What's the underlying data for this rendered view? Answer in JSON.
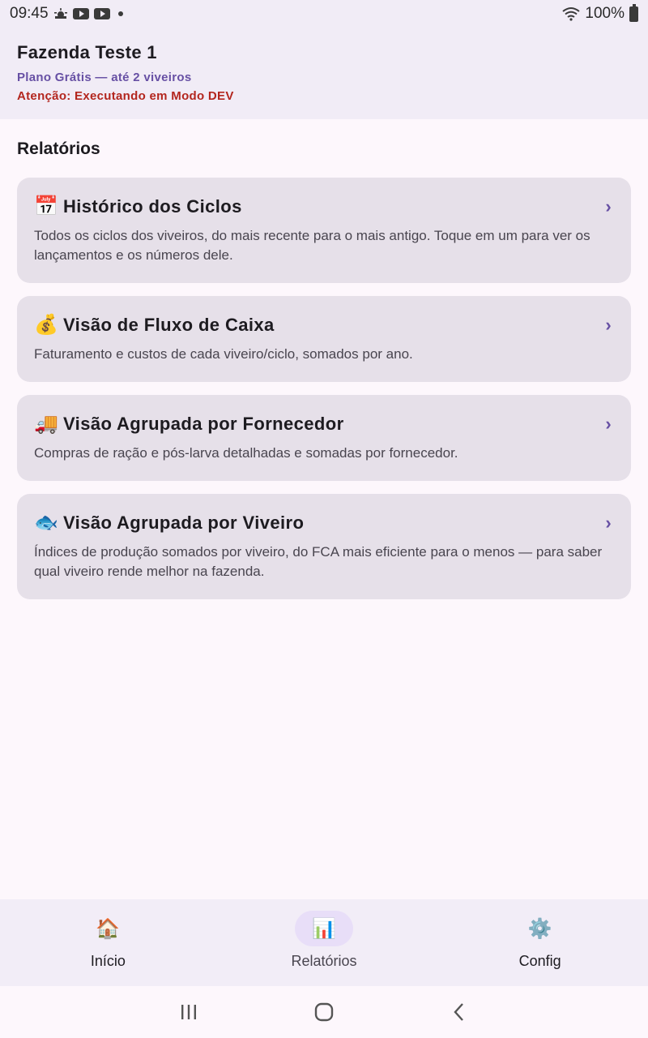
{
  "status_bar": {
    "time": "09:45",
    "battery": "100%",
    "icons": [
      "weather-icon",
      "youtube-icon",
      "youtube-icon",
      "notification-dot-icon",
      "wifi-icon",
      "battery-icon"
    ]
  },
  "header": {
    "farm_name": "Fazenda Teste 1",
    "plan": "Plano Grátis — até 2 viveiros",
    "dev_warning": "Atenção: Executando em Modo DEV"
  },
  "main": {
    "section_title": "Relatórios",
    "cards": [
      {
        "icon": "📅",
        "title": "Histórico dos Ciclos",
        "description": "Todos os ciclos dos viveiros, do mais recente para o mais antigo. Toque em um para ver os lançamentos e os números dele."
      },
      {
        "icon": "💰",
        "title": "Visão de Fluxo de Caixa",
        "description": "Faturamento e custos de cada viveiro/ciclo, somados por ano."
      },
      {
        "icon": "🚚",
        "title": "Visão Agrupada por Fornecedor",
        "description": "Compras de ração e pós-larva detalhadas e somadas por fornecedor."
      },
      {
        "icon": "🐟",
        "title": "Visão Agrupada por Viveiro",
        "description": "Índices de produção somados por viveiro, do FCA mais eficiente para o menos — para saber qual viveiro rende melhor na fazenda."
      }
    ],
    "chevron": "›"
  },
  "bottom_nav": {
    "items": [
      {
        "icon": "🏠",
        "label": "Início",
        "active": false
      },
      {
        "icon": "📊",
        "label": "Relatórios",
        "active": true
      },
      {
        "icon": "⚙️",
        "label": "Config",
        "active": false
      }
    ]
  },
  "colors": {
    "accent": "#6750a4",
    "warning": "#b3261e",
    "card_bg": "#e6e0e9",
    "header_bg": "#f1ecf6"
  }
}
